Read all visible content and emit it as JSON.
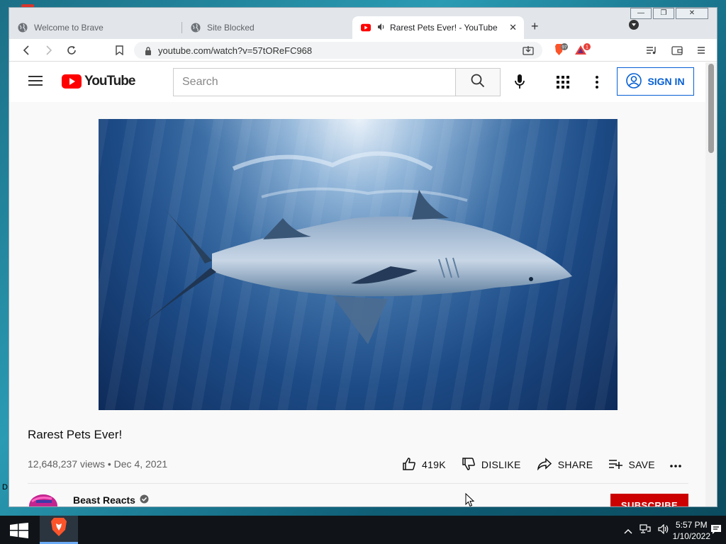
{
  "browser": {
    "tabs": [
      {
        "label": "Welcome to Brave",
        "icon": "globe-icon",
        "active": false
      },
      {
        "label": "Site Blocked",
        "icon": "globe-icon",
        "active": false
      },
      {
        "label": "Rarest Pets Ever! - YouTube",
        "icon": "youtube-icon",
        "active": true
      }
    ],
    "url": "youtube.com/watch?v=57tOReFC968",
    "shields_count": "97",
    "rewards_count": "1"
  },
  "youtube": {
    "logo_text": "YouTube",
    "search_placeholder": "Search",
    "sign_in_label": "SIGN IN"
  },
  "video": {
    "title": "Rarest Pets Ever!",
    "views": "12,648,237 views",
    "date": "Dec 4, 2021",
    "likes": "419K",
    "dislike_label": "DISLIKE",
    "share_label": "SHARE",
    "save_label": "SAVE",
    "channel_name": "Beast Reacts",
    "subscribe_label": "SUBSCRIBE"
  },
  "taskbar": {
    "time": "5:57 PM",
    "date": "1/10/2022"
  },
  "colors": {
    "youtube_red": "#ff0000",
    "subscribe_red": "#cc0000",
    "signin_blue": "#065fd4",
    "brave_orange": "#fb542b"
  }
}
